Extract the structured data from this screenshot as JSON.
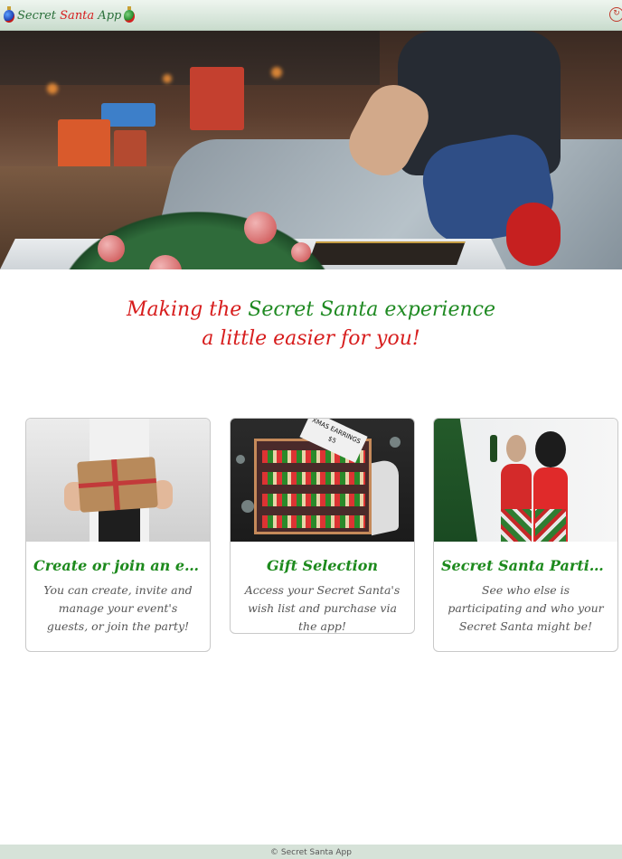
{
  "navbar": {
    "brand_part1": "Secret ",
    "brand_part2": "Santa",
    "brand_part3": " App",
    "brand_icons": [
      "ornament-icon",
      "ornament-icon"
    ],
    "right_icon": "logout-icon"
  },
  "hero": {
    "image": "christmas-wreath-living-room-photo"
  },
  "tagline": {
    "part1": "Making the ",
    "part2": "Secret Santa experience",
    "line2": "a little easier for you!"
  },
  "cards": [
    {
      "title": "Create or join an event",
      "text": "You can create, invite and manage your event's guests, or join the party!",
      "image": "gift-in-hands-photo"
    },
    {
      "title": "Gift Selection",
      "text": "Access your Secret Santa's wish list and purchase via the app!",
      "image": "earring-display-photo",
      "image_tag": "XMAS EARRINGS $5"
    },
    {
      "title": "Secret Santa Participa...",
      "text": "See who else is participating and who your Secret Santa might be!",
      "image": "two-women-celebrating-photo"
    }
  ],
  "footer": {
    "text": "© Secret Santa App"
  },
  "colors": {
    "brand_red": "#d71d1d",
    "brand_green": "#1f8a22",
    "navbar_bg": "#c9dccd"
  }
}
